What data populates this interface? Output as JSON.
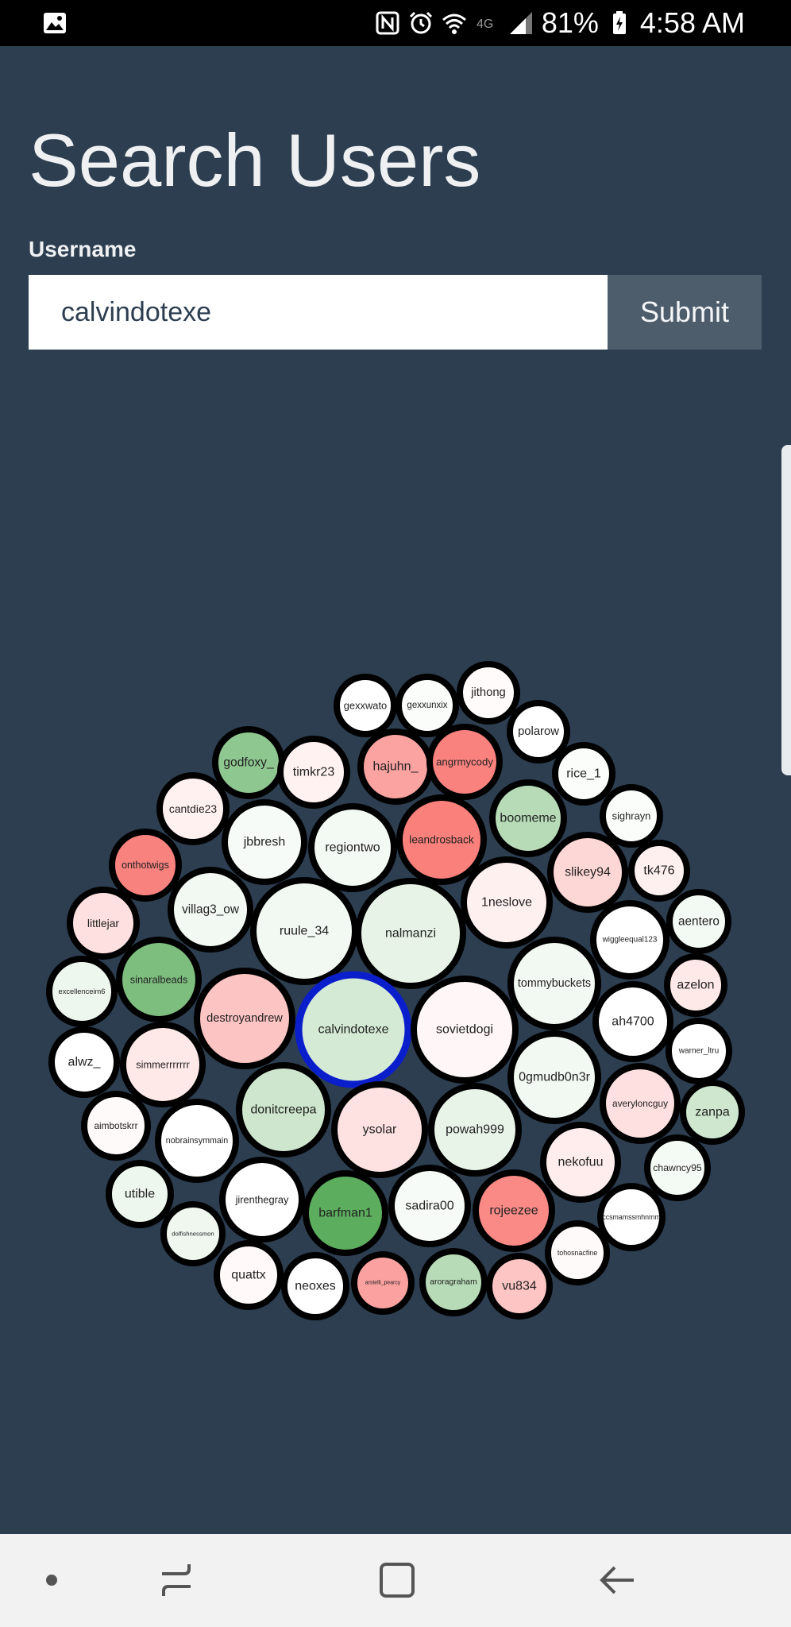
{
  "status_bar": {
    "battery": "81%",
    "time": "4:58 AM",
    "icons": [
      "image-icon",
      "nfc-icon",
      "alarm-icon",
      "wifi-icon",
      "lte-icon",
      "signal-icon",
      "battery-charging-icon"
    ]
  },
  "page": {
    "title": "Search Users",
    "username_label": "Username",
    "username_value": "calvindotexe",
    "submit_label": "Submit"
  },
  "colors": {
    "background": "#2c3e50",
    "submit": "#4e5d6c",
    "selected_ring": "#0a1ecc"
  },
  "bubbles": [
    {
      "name": "gexxwato",
      "color": "#ffffff"
    },
    {
      "name": "gexxunxix",
      "color": "#fbfdfb"
    },
    {
      "name": "jithong",
      "color": "#fffbfb"
    },
    {
      "name": "polarow",
      "color": "#ffffff"
    },
    {
      "name": "godfoxy_",
      "color": "#8ec78f"
    },
    {
      "name": "timkr23",
      "color": "#fff2f1"
    },
    {
      "name": "hajuhn_",
      "color": "#fba3a0"
    },
    {
      "name": "angrmycody",
      "color": "#f9827f"
    },
    {
      "name": "rice_1",
      "color": "#fafdfa"
    },
    {
      "name": "cantdie23",
      "color": "#fff1f0"
    },
    {
      "name": "boomeme",
      "color": "#b6dbb6"
    },
    {
      "name": "sighrayn",
      "color": "#fafdfa"
    },
    {
      "name": "jbbresh",
      "color": "#f7fbf7"
    },
    {
      "name": "regiontwo",
      "color": "#f3f9f3"
    },
    {
      "name": "leandrosback",
      "color": "#fa807c"
    },
    {
      "name": "slikey94",
      "color": "#fdd7d6"
    },
    {
      "name": "tk476",
      "color": "#fff0f0"
    },
    {
      "name": "onthotwigs",
      "color": "#f8827e"
    },
    {
      "name": "1neslove",
      "color": "#fff0f0"
    },
    {
      "name": "villag3_ow",
      "color": "#f2f8f2"
    },
    {
      "name": "ruule_34",
      "color": "#f2f8f2"
    },
    {
      "name": "nalmanzi",
      "color": "#e7f3e7"
    },
    {
      "name": "aentero",
      "color": "#f3f9f3"
    },
    {
      "name": "littlejar",
      "color": "#fde0df"
    },
    {
      "name": "wiggleequal123",
      "color": "#fefffe"
    },
    {
      "name": "tommybuckets",
      "color": "#f2f8f2"
    },
    {
      "name": "excellenceim6",
      "color": "#eef7ee"
    },
    {
      "name": "sinaralbeads",
      "color": "#7dbd7e"
    },
    {
      "name": "azelon",
      "color": "#ffe9e8"
    },
    {
      "name": "destroyandrew",
      "color": "#fcc4c2"
    },
    {
      "name": "calvindotexe",
      "color": "#d4ead4",
      "selected": true
    },
    {
      "name": "sovietdogi",
      "color": "#fff7f7"
    },
    {
      "name": "ah4700",
      "color": "#ffffff"
    },
    {
      "name": "warner_ltru",
      "color": "#ffffff"
    },
    {
      "name": "alwz_",
      "color": "#ffffff"
    },
    {
      "name": "simmerrrrrrr",
      "color": "#ffe9e8"
    },
    {
      "name": "0gmudb0n3r",
      "color": "#f2f8f2"
    },
    {
      "name": "averyloncguy",
      "color": "#fde0df"
    },
    {
      "name": "zanpa",
      "color": "#cfe7cf"
    },
    {
      "name": "donitcreepa",
      "color": "#cde6cd"
    },
    {
      "name": "aimbotskrr",
      "color": "#fffafa"
    },
    {
      "name": "ysolar",
      "color": "#fde2e1"
    },
    {
      "name": "powah999",
      "color": "#e9f4e9"
    },
    {
      "name": "nobrainsymmain",
      "color": "#ffffff"
    },
    {
      "name": "nekofuu",
      "color": "#ffeded"
    },
    {
      "name": "chawncy95",
      "color": "#f4faf4"
    },
    {
      "name": "utible",
      "color": "#eef7ee"
    },
    {
      "name": "jirenthegray",
      "color": "#ffffff"
    },
    {
      "name": "barfman1",
      "color": "#5dad5e"
    },
    {
      "name": "sadira00",
      "color": "#f7fbf7"
    },
    {
      "name": "rojeezee",
      "color": "#f98a86"
    },
    {
      "name": "ccsmamssmhnmm",
      "color": "#ffffff"
    },
    {
      "name": "dolfishnessmon",
      "color": "#eff7ef"
    },
    {
      "name": "tohosnacfine",
      "color": "#fffafa"
    },
    {
      "name": "quattx",
      "color": "#fff9f9"
    },
    {
      "name": "neoxes",
      "color": "#ffffff"
    },
    {
      "name": "arstelli_pearcy",
      "color": "#fba2a0"
    },
    {
      "name": "aroragraham",
      "color": "#b6dbb6"
    },
    {
      "name": "vu834",
      "color": "#fdc6c4"
    }
  ]
}
